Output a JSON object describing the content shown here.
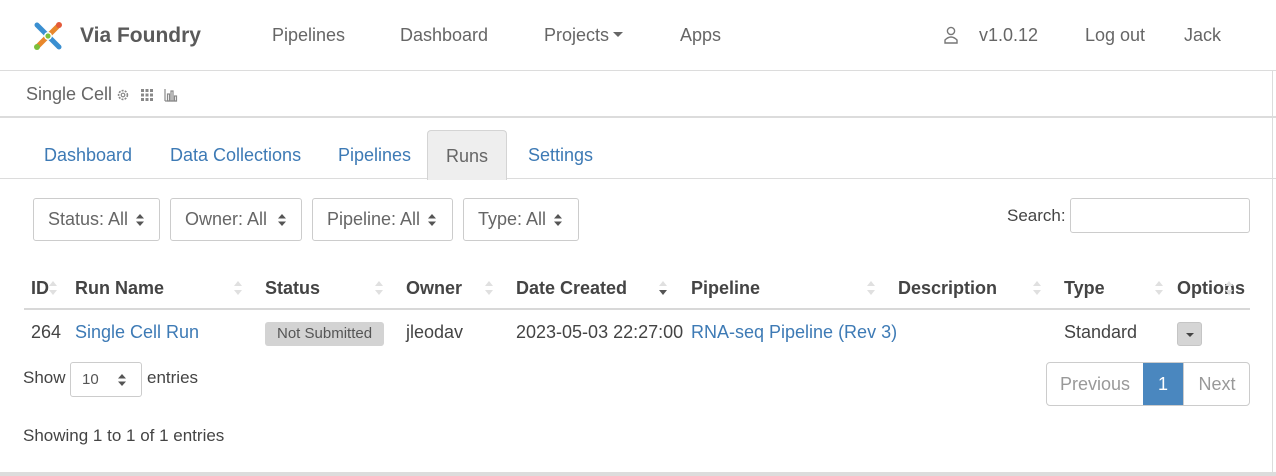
{
  "navbar": {
    "brand": "Via Foundry",
    "links": [
      {
        "label": "Pipelines"
      },
      {
        "label": "Dashboard"
      },
      {
        "label": "Projects"
      },
      {
        "label": "Apps"
      }
    ],
    "version": "v1.0.12",
    "logout": "Log out",
    "user": "Jack"
  },
  "project": {
    "title": "Single Cell",
    "icons": [
      "gear-icon",
      "grid-icon",
      "bar-chart-icon"
    ]
  },
  "tabs": [
    {
      "label": "Dashboard",
      "active": false
    },
    {
      "label": "Data Collections",
      "active": false
    },
    {
      "label": "Pipelines",
      "active": false
    },
    {
      "label": "Runs",
      "active": true
    },
    {
      "label": "Settings",
      "active": false
    }
  ],
  "filters": [
    {
      "label": "Status: All"
    },
    {
      "label": "Owner: All"
    },
    {
      "label": "Pipeline: All"
    },
    {
      "label": "Type: All"
    }
  ],
  "search": {
    "label": "Search:",
    "value": ""
  },
  "table": {
    "columns": [
      "ID",
      "Run Name",
      "Status",
      "Owner",
      "Date Created",
      "Pipeline",
      "Description",
      "Type",
      "Options"
    ],
    "sorted_column": "Date Created",
    "sort_direction": "descending",
    "rows": [
      {
        "id": "264",
        "run_name": "Single Cell Run",
        "status": "Not Submitted",
        "owner": "jleodav",
        "date_created": "2023-05-03 22:27:00",
        "pipeline": "RNA-seq Pipeline (Rev 3)",
        "description": "",
        "type": "Standard"
      }
    ]
  },
  "length": {
    "show": "Show",
    "value": "10",
    "entries": "entries"
  },
  "pagination": {
    "previous": "Previous",
    "current": "1",
    "next": "Next"
  },
  "info": "Showing 1 to 1 of 1 entries",
  "colors": {
    "link": "#3d7ab5",
    "active_page": "#4a87bf",
    "badge": "#d3d3d3"
  }
}
